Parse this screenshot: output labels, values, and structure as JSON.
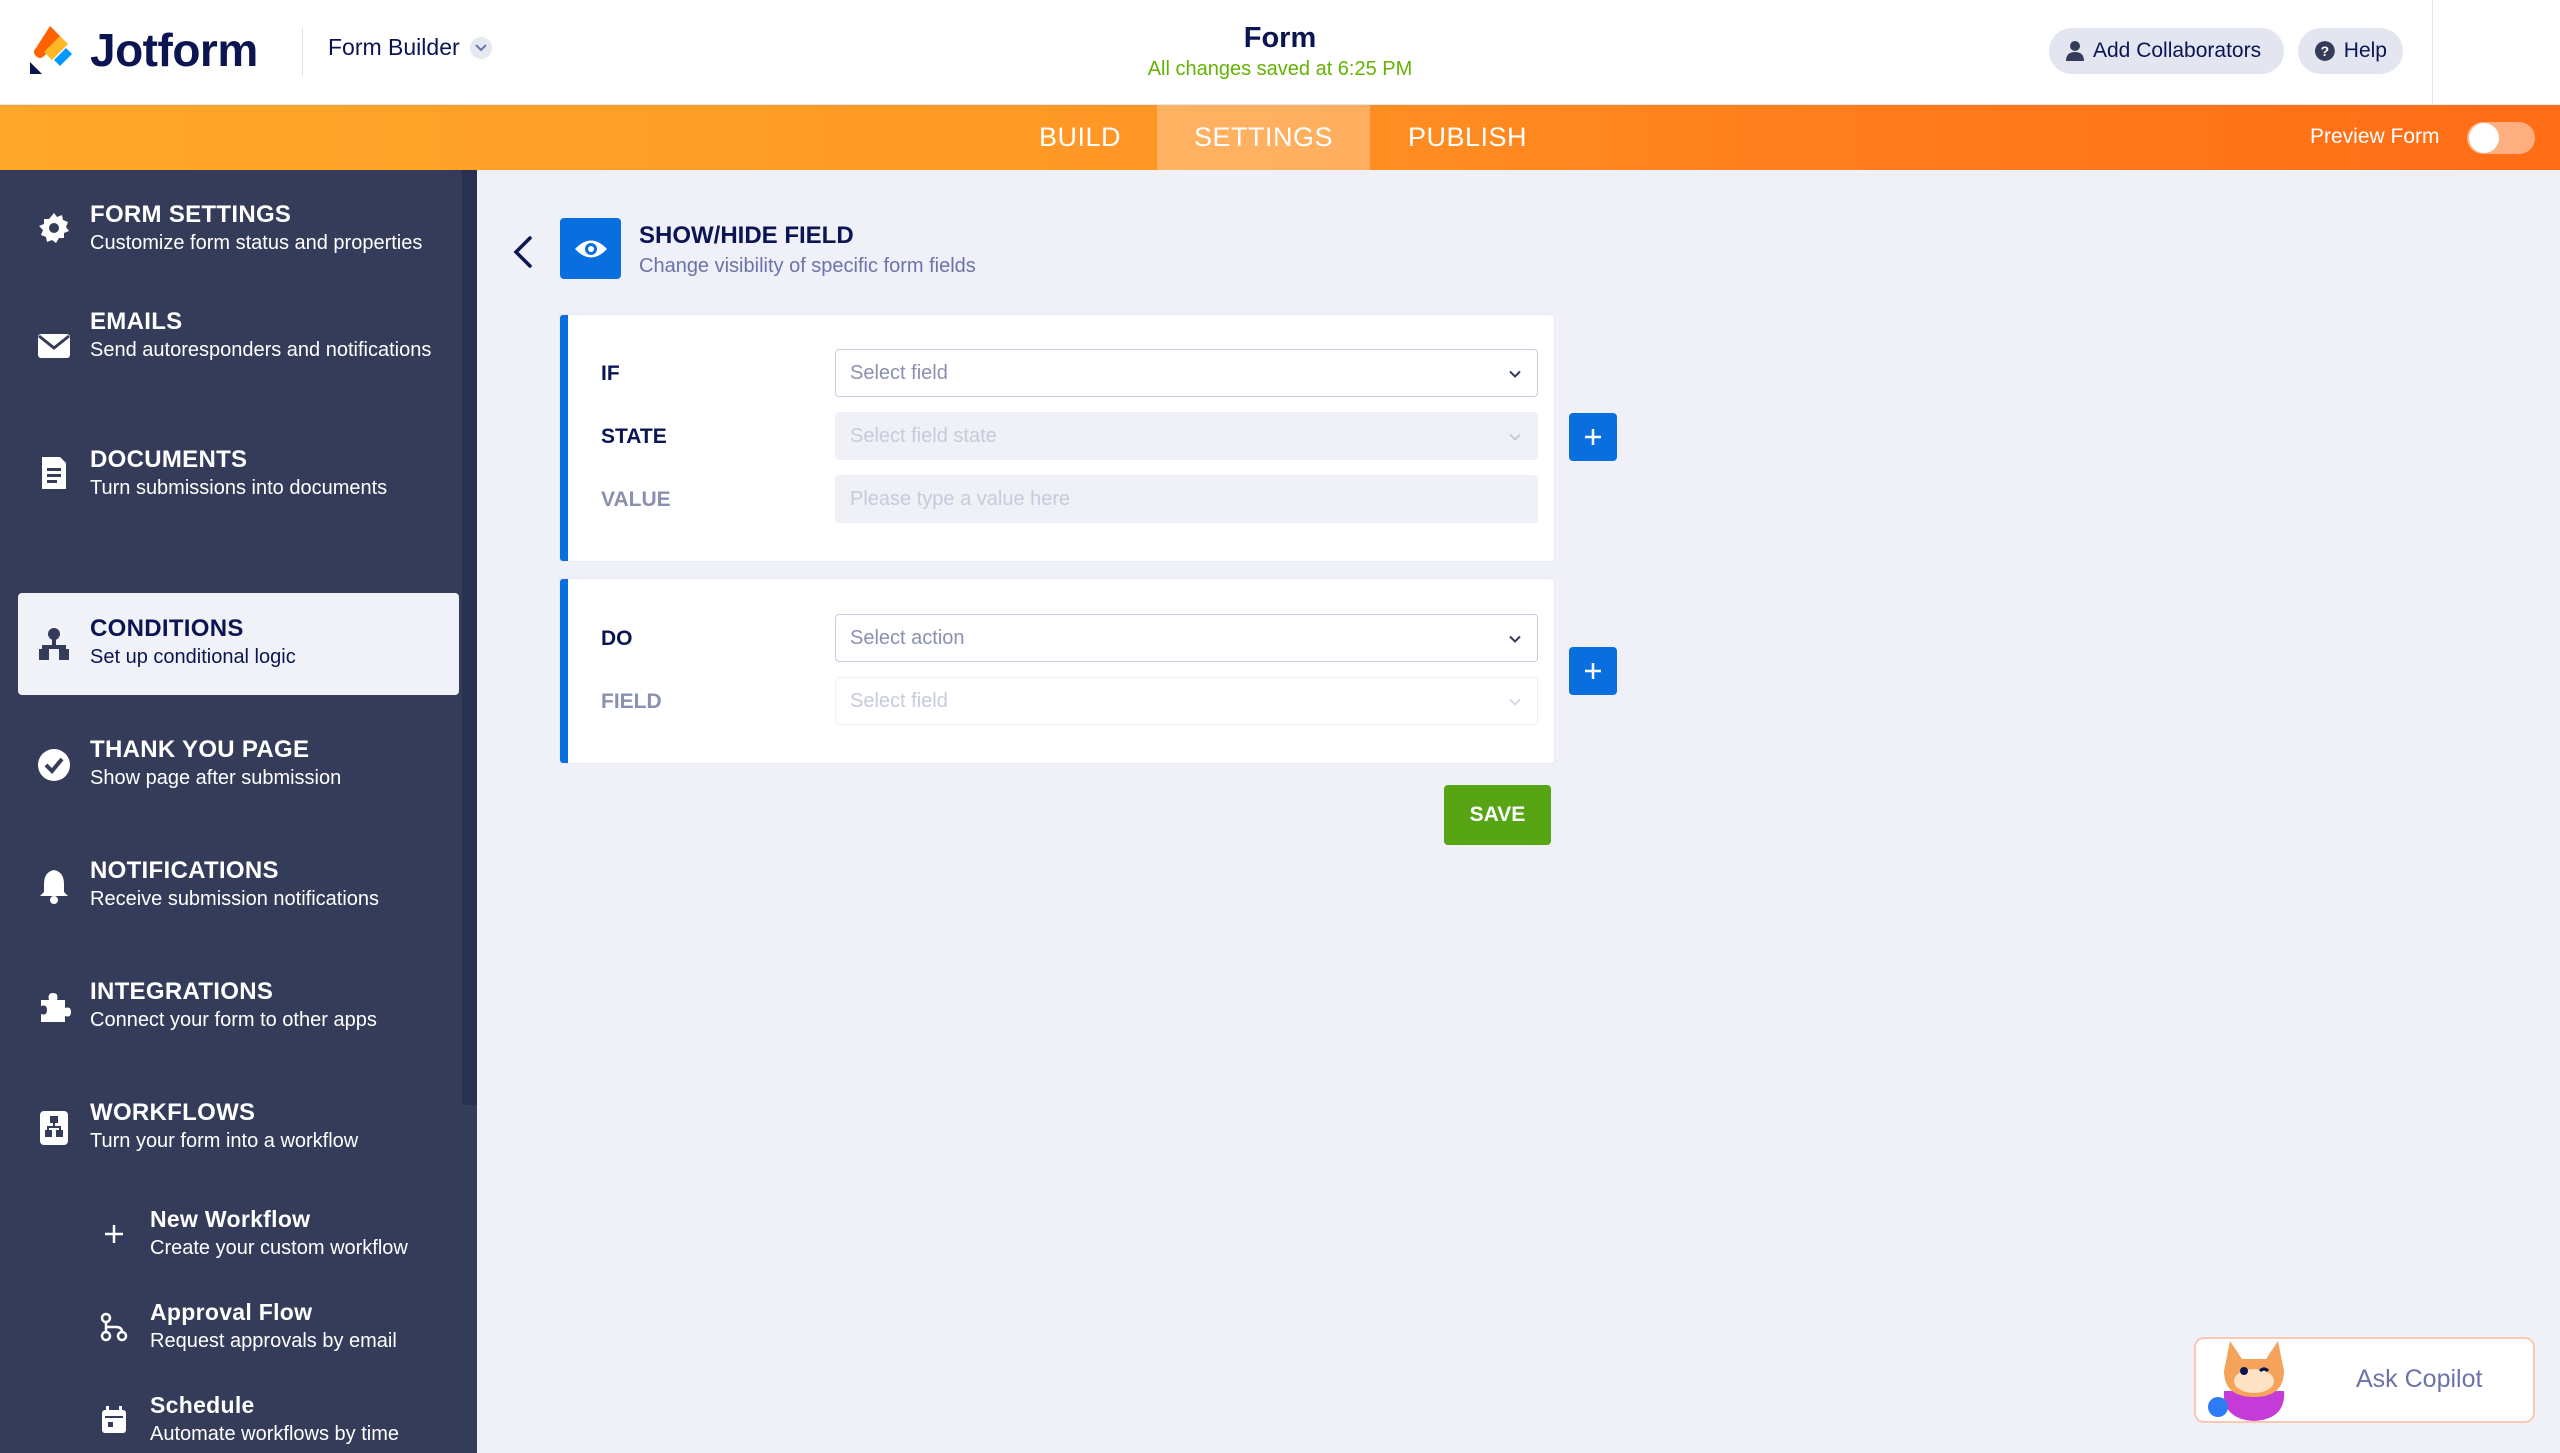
{
  "app": {
    "logo_text": "Jotform",
    "builder_menu_label": "Form Builder",
    "form_title": "Form",
    "save_status": "All changes saved at 6:25 PM",
    "collaborators_label": "Add Collaborators",
    "help_label": "Help"
  },
  "nav": {
    "tabs": [
      {
        "label": "BUILD",
        "active": false
      },
      {
        "label": "SETTINGS",
        "active": true
      },
      {
        "label": "PUBLISH",
        "active": false
      }
    ],
    "preview_label": "Preview Form",
    "preview_enabled": false
  },
  "sidebar": {
    "items": [
      {
        "title": "FORM SETTINGS",
        "desc": "Customize form status and properties",
        "icon": "gear-icon"
      },
      {
        "title": "EMAILS",
        "desc": "Send autoresponders and notifications",
        "icon": "envelope-icon"
      },
      {
        "title": "DOCUMENTS",
        "desc": "Turn submissions into documents",
        "icon": "document-icon"
      },
      {
        "title": "CONDITIONS",
        "desc": "Set up conditional logic",
        "icon": "conditions-icon",
        "active": true
      },
      {
        "title": "THANK YOU PAGE",
        "desc": "Show page after submission",
        "icon": "check-circle-icon"
      },
      {
        "title": "NOTIFICATIONS",
        "desc": "Receive submission notifications",
        "icon": "bell-icon"
      },
      {
        "title": "INTEGRATIONS",
        "desc": "Connect your form to other apps",
        "icon": "puzzle-icon"
      },
      {
        "title": "WORKFLOWS",
        "desc": "Turn your form into a workflow",
        "icon": "workflow-icon"
      }
    ],
    "workflow_subitems": [
      {
        "title": "New Workflow",
        "desc": "Create your custom workflow",
        "icon": "plus-icon"
      },
      {
        "title": "Approval Flow",
        "desc": "Request approvals by email",
        "icon": "approval-flow-icon"
      },
      {
        "title": "Schedule",
        "desc": "Automate workflows by time",
        "icon": "calendar-icon"
      }
    ]
  },
  "condition": {
    "title": "SHOW/HIDE FIELD",
    "subtitle": "Change visibility of specific form fields",
    "if_block": {
      "if_label": "IF",
      "if_placeholder": "Select field",
      "state_label": "STATE",
      "state_placeholder": "Select field state",
      "value_label": "VALUE",
      "value_placeholder": "Please type a value here"
    },
    "do_block": {
      "do_label": "DO",
      "do_placeholder": "Select action",
      "field_label": "FIELD",
      "field_placeholder": "Select field"
    },
    "save_label": "SAVE"
  },
  "copilot": {
    "label": "Ask Copilot"
  },
  "colors": {
    "accent_blue": "#0a6fde",
    "save_green": "#57a515",
    "status_green": "#64b202",
    "nav_orange": "#ff8a20",
    "sidebar_bg": "#343c5a",
    "text_navy": "#0a1551"
  }
}
